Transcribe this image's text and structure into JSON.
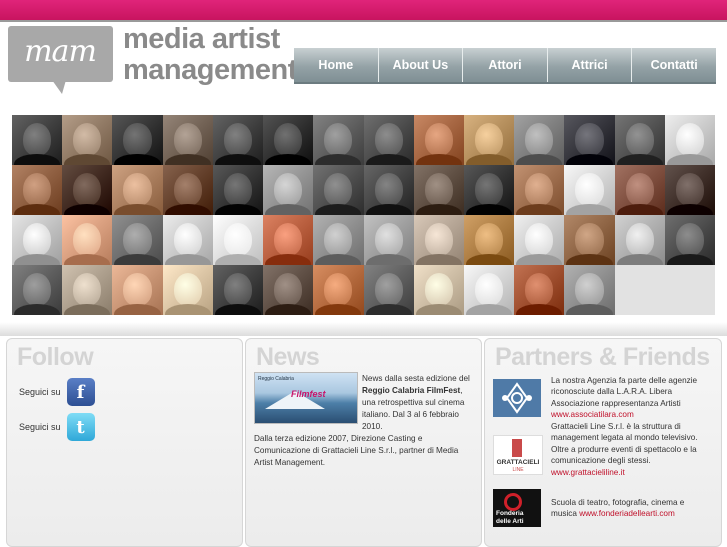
{
  "header": {
    "logo_mark": "mam",
    "logo_line1": "media artist",
    "logo_line2": "management"
  },
  "nav": {
    "items": [
      {
        "label": "Home"
      },
      {
        "label": "About Us"
      },
      {
        "label": "Attori"
      },
      {
        "label": "Attrici"
      },
      {
        "label": "Contatti"
      }
    ]
  },
  "faces": {
    "tones": [
      "#3a3a3a",
      "#8c7560",
      "#2e2e2e",
      "#6d5d50",
      "#3b3b3b",
      "#2b2b2b",
      "#5a5a5a",
      "#474747",
      "#a0603c",
      "#b08a58",
      "#7a7a7a",
      "#2f2f36",
      "#4d4d4d",
      "#c6c6c6",
      "#8a5a3c",
      "#3b2418",
      "#a67a5a",
      "#5e3a25",
      "#303030",
      "#8f8f8f",
      "#4a4a4a",
      "#3e3e3e",
      "#5a4a3e",
      "#2f2f2f",
      "#9a6a4a",
      "#d0d0d0",
      "#7a4a3a",
      "#3a2a24",
      "#bdbdbd",
      "#d49a7a",
      "#686868",
      "#c4c4c4",
      "#dcdcdc",
      "#b45a3a",
      "#8a8a8a",
      "#9a9a9a",
      "#b0a090",
      "#a8783e",
      "#c8c8c8",
      "#8a6040",
      "#aaaaaa",
      "#474747",
      "#585858",
      "#a89a88",
      "#c49070",
      "#d6c0a0",
      "#3a3a3a",
      "#5a4a40",
      "#b0663a",
      "#5a5a5a",
      "#c8b8a0",
      "#d0d0d0",
      "#9a4a2a",
      "#8a8a8a",
      "#e2e2e2",
      "#e2e2e2"
    ]
  },
  "follow": {
    "title": "Follow",
    "rows": [
      {
        "label": "Seguici su",
        "icon": "facebook-icon",
        "glyph": "f"
      },
      {
        "label": "Seguici su",
        "icon": "twitter-icon",
        "glyph": "t"
      }
    ]
  },
  "news": {
    "title": "News",
    "image_logo": "Filmfest",
    "image_small": "Reggio Calabria",
    "p1_a": "News dalla sesta edizione del ",
    "p1_bold": "Reggio Calabria FilmFest",
    "p1_b": ", una retrospettiva sul cinema italiano. Dal 3 al 6 febbraio 2010.",
    "p2": "Dalla terza edizione 2007, Direzione Casting e Comunicazione di Grattacieli Line S.r.l., partner di Media Artist Management."
  },
  "partners": {
    "title": "Partners & Friends",
    "items": [
      {
        "text": "La nostra Agenzia fa parte delle agenzie riconosciute dalla L.A.R.A. Libera Associazione rappresentanza Artisti ",
        "link": "www.associatilara.com"
      },
      {
        "text": "Grattacieli Line S.r.l. è la struttura di management legata al mondo televisivo. Oltre a produrre eventi di spettacolo e la comunicazione degli stessi. ",
        "link": "www.grattacieliline.it",
        "logo_text": "GRATTACIELI",
        "logo_sub": "LINE"
      },
      {
        "text": "Scuola di teatro, fotografia, cinema e musica ",
        "link": "www.fonderiadellearti.com",
        "logo_text": "Fonderia delle Arti"
      }
    ]
  }
}
